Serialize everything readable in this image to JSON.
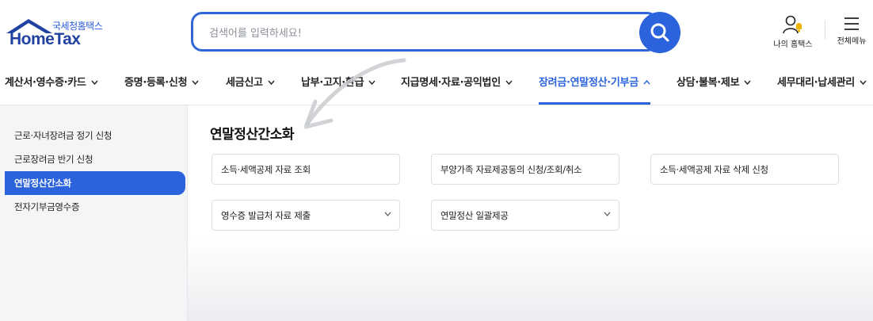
{
  "brand": {
    "subtitle": "국세청홈택스",
    "name": "HomeTax"
  },
  "search": {
    "placeholder": "검색어를 입력하세요!"
  },
  "header": {
    "my_hometax": "나의 홈택스",
    "all_menu": "전체메뉴"
  },
  "nav": {
    "items": [
      {
        "label": "계산서·영수증·카드"
      },
      {
        "label": "증명·등록·신청"
      },
      {
        "label": "세금신고"
      },
      {
        "label": "납부·고지·환급"
      },
      {
        "label": "지급명세·자료·공익법인"
      },
      {
        "label": "장려금·연말정산·기부금"
      },
      {
        "label": "상담·불복·제보"
      },
      {
        "label": "세무대리·납세관리"
      }
    ],
    "active_index": 5
  },
  "sidebar": {
    "items": [
      {
        "label": "근로·자녀장려금 정기 신청"
      },
      {
        "label": "근로장려금 반기 신청"
      },
      {
        "label": "연말정산간소화"
      },
      {
        "label": "전자기부금영수증"
      }
    ],
    "active_index": 2
  },
  "main": {
    "title": "연말정산간소화",
    "cards": [
      {
        "label": "소득·세액공제 자료 조회"
      },
      {
        "label": "부양가족 자료제공동의 신청/조회/취소"
      },
      {
        "label": "소득·세액공제 자료 삭제 신청"
      },
      {
        "label": "영수증 발급처 자료 제출"
      },
      {
        "label": "연말정산 일괄제공"
      }
    ]
  },
  "colors": {
    "accent": "#2b63dd",
    "brand_dark": "#2142a0",
    "sidebar_bg": "#f4f5f7"
  }
}
